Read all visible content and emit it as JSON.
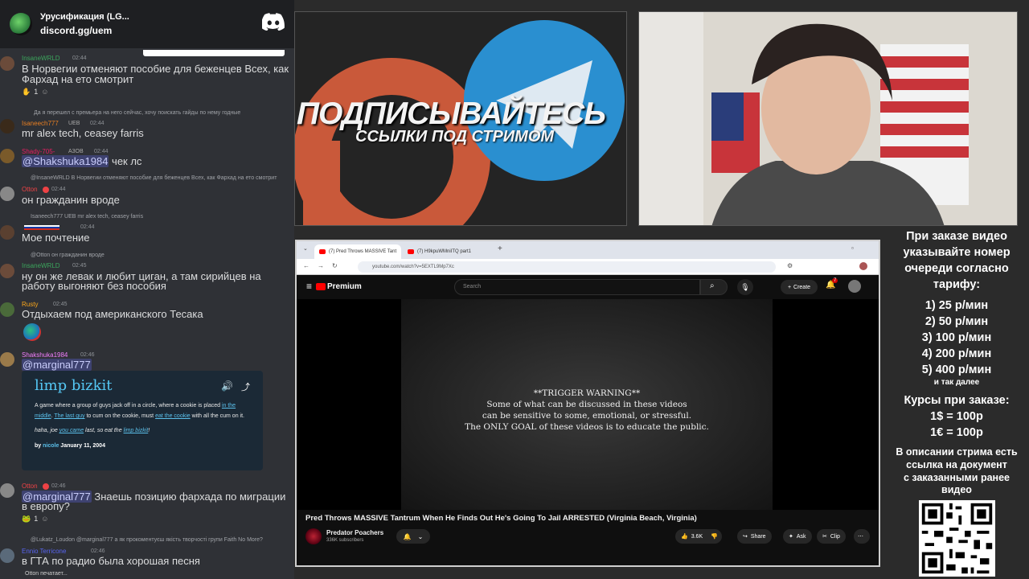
{
  "discord": {
    "server_name": "Урусификация (LG...",
    "invite": "discord.gg/uem"
  },
  "messages": [
    {
      "user": "InsaneWRLD",
      "time": "02:44",
      "color": "#3ba55c",
      "lines": [
        "В Норвегии отменяют пособие для беженцев Всех, как",
        "Фархад на ето смотрит"
      ],
      "reaction": "1"
    },
    {
      "reply": "Да я перешел с премьера на него сейчас, хочу поискать гайды по нему годные",
      "user": "Isaneech777",
      "tag": "UEB",
      "time": "02:44",
      "color": "#e67e22",
      "lines": [
        "mr alex tech, ceasey farris"
      ]
    },
    {
      "user": "Shady-705-",
      "tag": "A3OB",
      "time": "02:44",
      "color": "#e91e63",
      "mention": "@Shakshuka1984",
      "text_after": " чек лс"
    },
    {
      "reply": "@InsaneWRLD В Норвегии отменяют пособие для беженцев Всех, как Фархад на ето смотрит",
      "user": "Otton",
      "time": "02:44",
      "color": "#ed4245",
      "lines": [
        "он гражданин вроде"
      ]
    },
    {
      "reply": "Isaneech777 UEB mr alex tech, ceasey farris",
      "user": "",
      "time": "02:44",
      "color": "#ffffff",
      "lines": [
        "Мое почтение"
      ]
    },
    {
      "reply": "@Otton он гражданин вроде",
      "user": "InsaneWRLD",
      "time": "02:45",
      "color": "#3ba55c",
      "lines": [
        "ну он же левак и любит циган, а там сирийцев на",
        "работу выгоняют без пособия"
      ]
    },
    {
      "user": "Rusty",
      "time": "02:45",
      "color": "#faa61a",
      "lines": [
        "Отдыхаем под американского Тесака"
      ]
    },
    {
      "user": "Shakshuka1984",
      "time": "02:46",
      "color": "#f47fff",
      "mention": "@marginal777",
      "text_after": ""
    },
    {
      "user": "Otton",
      "time": "02:46",
      "color": "#ed4245",
      "mention": "@marginal777",
      "text_after": " Знаешь позицию фархада по миграции",
      "line2": "в европу?",
      "reaction": "1"
    },
    {
      "reply": "@Lukatz_Loudon @marginal777 а як прокоментуєш якість творчості групи Faith No More?",
      "user": "Ennio Terricone",
      "time": "02:46",
      "color": "#5865f2",
      "lines": [
        "в ГТА по радио была хорошая песня"
      ]
    }
  ],
  "ud_embed": {
    "word": "limp bizkit",
    "def_1": "A game where a group of guys jack off in a circle, where a cookie is placed ",
    "link_1": "in the middle",
    "def_2": ". ",
    "link_2": "The last guy",
    "def_3": " to cum on the cookie, must ",
    "link_3": "eat the cookie",
    "def_4": " with all the cum on it.",
    "ex_1": "haha, joe ",
    "ex_link_1": "you came",
    "ex_2": " last, so eat the ",
    "ex_link_2": "limp bizkit",
    "ex_3": "!",
    "by": "by ",
    "author": "nicole",
    "date": " January 11, 2004"
  },
  "typing": "Otton печатает...",
  "promo": {
    "title": "ПОДПИСЫВАЙТЕСЬ",
    "subtitle": "ССЫЛКИ ПОД СТРИМОМ"
  },
  "browser": {
    "tab1": "(7) Pred Throws MASSIVE Tant",
    "tab2": "(7) H9kpuWMniITQ part1",
    "url": "youtube.com/watch?v=5EXTL9Mp7Xc",
    "yt_brand": "Premium",
    "search_placeholder": "Search",
    "create": "Create",
    "notif_count": "7",
    "trigger_lines": [
      "**TRIGGER WARNING**",
      "Some of what can be discussed in these videos",
      "can be sensitive to some, emotional, or stressful.",
      "The ONLY GOAL of these videos is to educate the public."
    ],
    "video_title": "Pred Throws MASSIVE Tantrum When He Finds Out He's Going To Jail ARRESTED (Virginia Beach, Virginia)",
    "channel": "Predator Poachers",
    "subs": "336K subscribers",
    "likes": "3.6K",
    "share": "Share",
    "ask": "Ask",
    "clip": "Clip"
  },
  "info": {
    "l1": "При заказе видео",
    "l2": "указывайте номер",
    "l3": "очереди согласно",
    "l4": "тарифу:",
    "p1": "1) 25 р/мин",
    "p2": "2) 50 р/мин",
    "p3": "3) 100 р/мин",
    "p4": "4) 200 р/мин",
    "p5": "5) 400 р/мин",
    "etc": "и так далее",
    "c1": "Курсы при заказе:",
    "c2": "1$ = 100р",
    "c3": "1€ = 100р",
    "d1": "В описании стрима есть",
    "d2": "ссылка на документ",
    "d3": "с заказанными ранее",
    "d4": "видео"
  }
}
